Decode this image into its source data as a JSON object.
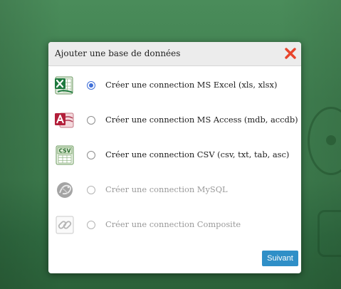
{
  "dialog": {
    "title": "Ajouter une base de données",
    "options": [
      {
        "label": "Créer une connection MS Excel (xls, xlsx)",
        "icon": "excel-icon",
        "selected": true,
        "enabled": true
      },
      {
        "label": "Créer une connection MS Access (mdb, accdb)",
        "icon": "access-icon",
        "selected": false,
        "enabled": true
      },
      {
        "label": "Créer une connection CSV (csv, txt, tab, asc)",
        "icon": "csv-icon",
        "selected": false,
        "enabled": true
      },
      {
        "label": "Créer une connection MySQL",
        "icon": "mysql-icon",
        "selected": false,
        "enabled": false
      },
      {
        "label": "Créer une connection Composite",
        "icon": "composite-link-icon",
        "selected": false,
        "enabled": false
      }
    ],
    "next_button_label": "Suivant",
    "csv_icon_text": "CSV"
  },
  "colors": {
    "close_icon": "#e8452c",
    "radio_selected": "#3f6fd8",
    "next_button": "#2f8fc7",
    "background": "#3f7e4f"
  }
}
